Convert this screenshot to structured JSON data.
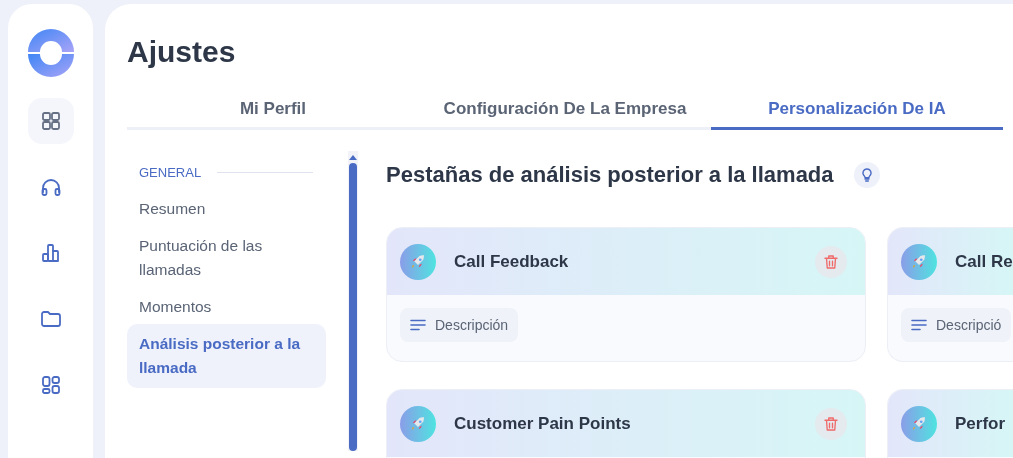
{
  "rail": {
    "items": [
      {
        "kind": "grid",
        "selected": true
      },
      {
        "kind": "headset",
        "selected": false
      },
      {
        "kind": "chart",
        "selected": false
      },
      {
        "kind": "folder",
        "selected": false
      },
      {
        "kind": "widgets",
        "selected": false
      }
    ]
  },
  "page": {
    "title": "Ajustes"
  },
  "tabs": [
    {
      "label": "Mi Perfil",
      "selected": false
    },
    {
      "label": "Configuración De La Empresa",
      "selected": false
    },
    {
      "label": "Personalización De IA",
      "selected": true
    }
  ],
  "sidebar": {
    "section_label": "GENERAL",
    "items": [
      {
        "label": "Resumen",
        "selected": false
      },
      {
        "label": "Puntuación de las llamadas",
        "selected": false
      },
      {
        "label": "Momentos",
        "selected": false
      },
      {
        "label": "Análisis posterior a la llamada",
        "selected": true
      }
    ]
  },
  "section": {
    "title": "Pestañas de análisis posterior a la llamada"
  },
  "cards": [
    {
      "title": "Call Feedback",
      "field": "Descripción"
    },
    {
      "title": "Call Re",
      "field": "Descripció"
    },
    {
      "title": "Customer Pain Points"
    },
    {
      "title": "Perfor"
    }
  ]
}
